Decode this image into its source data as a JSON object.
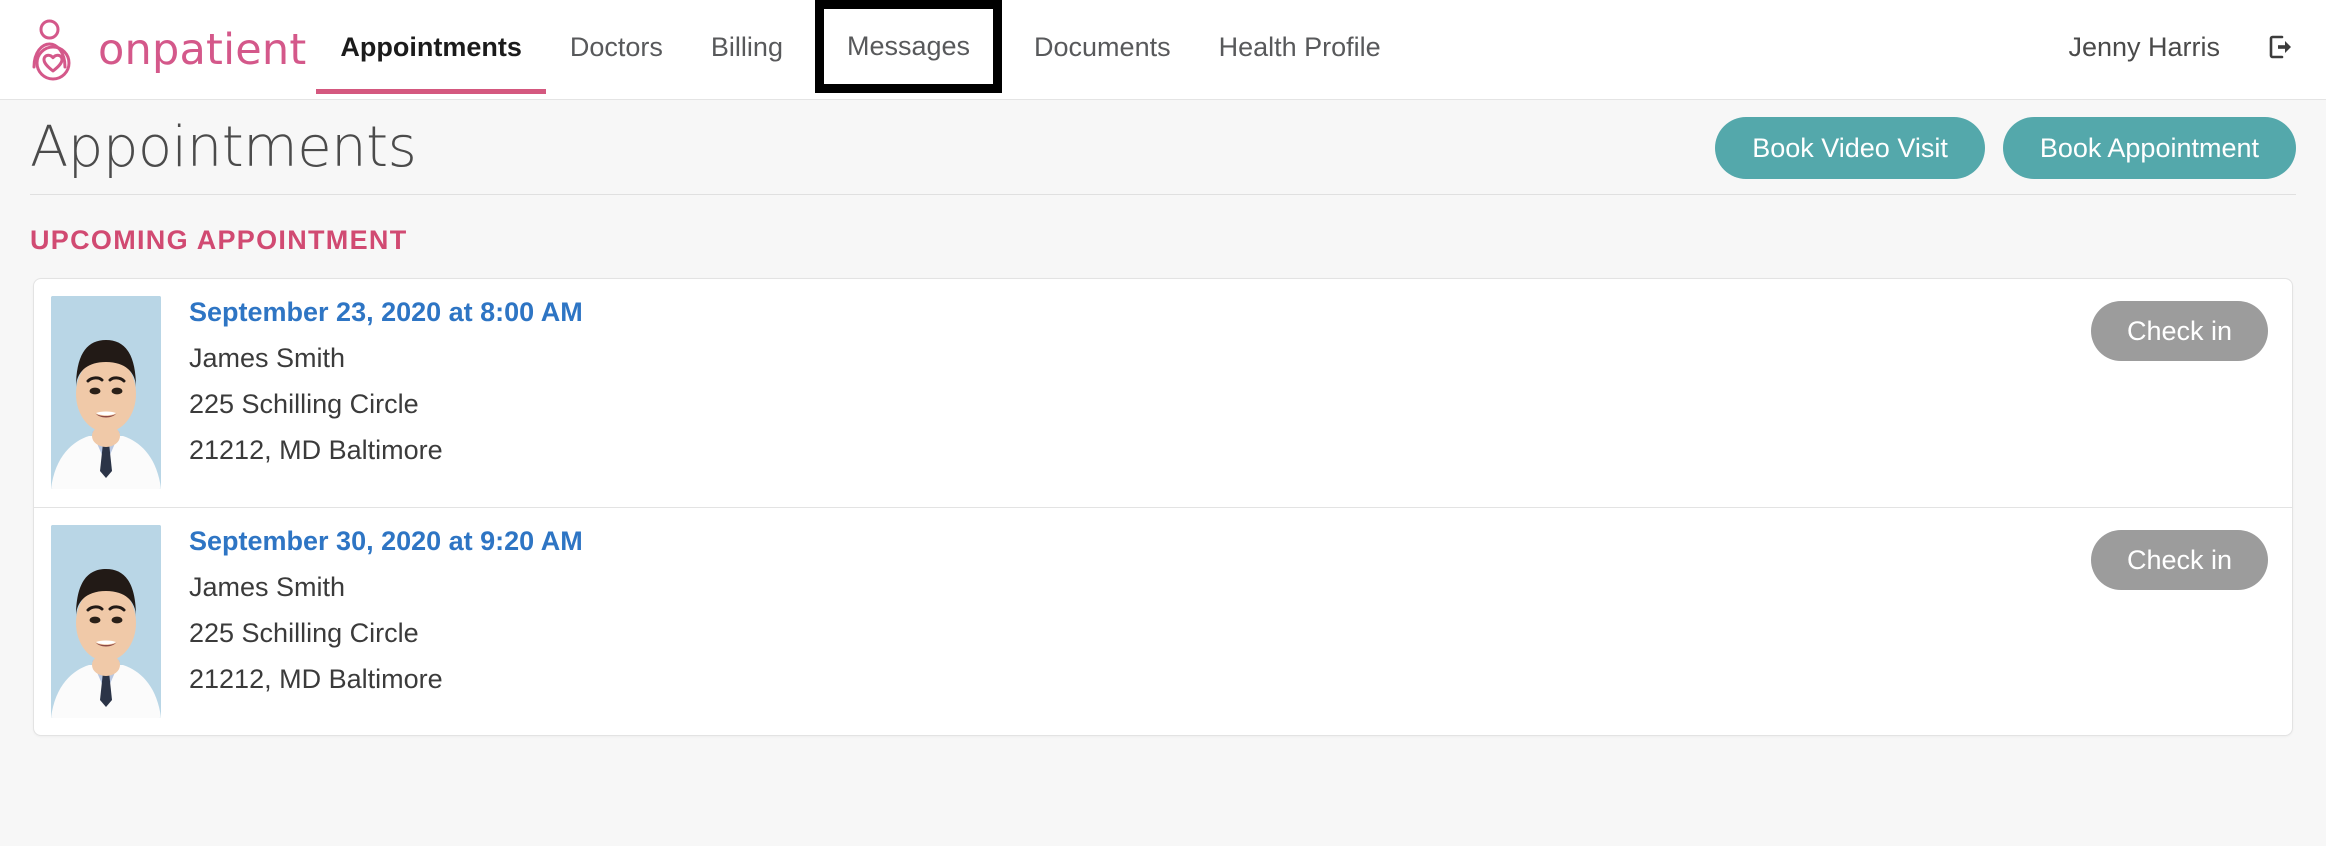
{
  "brand": {
    "name": "onpatient",
    "logo_icon": "onpatient-person-heart-logo",
    "color": "#d4588a"
  },
  "nav": {
    "items": [
      {
        "label": "Appointments",
        "state": "active"
      },
      {
        "label": "Doctors",
        "state": "default"
      },
      {
        "label": "Billing",
        "state": "default"
      },
      {
        "label": "Messages",
        "state": "highlighted"
      },
      {
        "label": "Documents",
        "state": "default"
      },
      {
        "label": "Health Profile",
        "state": "default"
      }
    ],
    "highlight_color": "#000000",
    "active_underline_color": "#d4587f"
  },
  "account": {
    "user_name": "Jenny Harris",
    "signout_icon": "sign-out-icon"
  },
  "page": {
    "title": "Appointments",
    "buttons": [
      {
        "label": "Book Video Visit",
        "color": "#54a8ab"
      },
      {
        "label": "Book Appointment",
        "color": "#54a8ab"
      }
    ]
  },
  "section": {
    "label": "UPCOMING APPOINTMENT",
    "label_color": "#d14a72"
  },
  "appointments": [
    {
      "datetime": "September 23, 2020 at 8:00 AM",
      "provider": "James Smith",
      "address_line1": "225 Schilling Circle",
      "address_line2": "21212, MD Baltimore",
      "action_label": "Check in",
      "action_color": "#9c9c9c",
      "avatar_icon": "doctor-portrait-avatar"
    },
    {
      "datetime": "September 30, 2020 at 9:20 AM",
      "provider": "James Smith",
      "address_line1": "225 Schilling Circle",
      "address_line2": "21212, MD Baltimore",
      "action_label": "Check in",
      "action_color": "#9c9c9c",
      "avatar_icon": "doctor-portrait-avatar"
    }
  ]
}
